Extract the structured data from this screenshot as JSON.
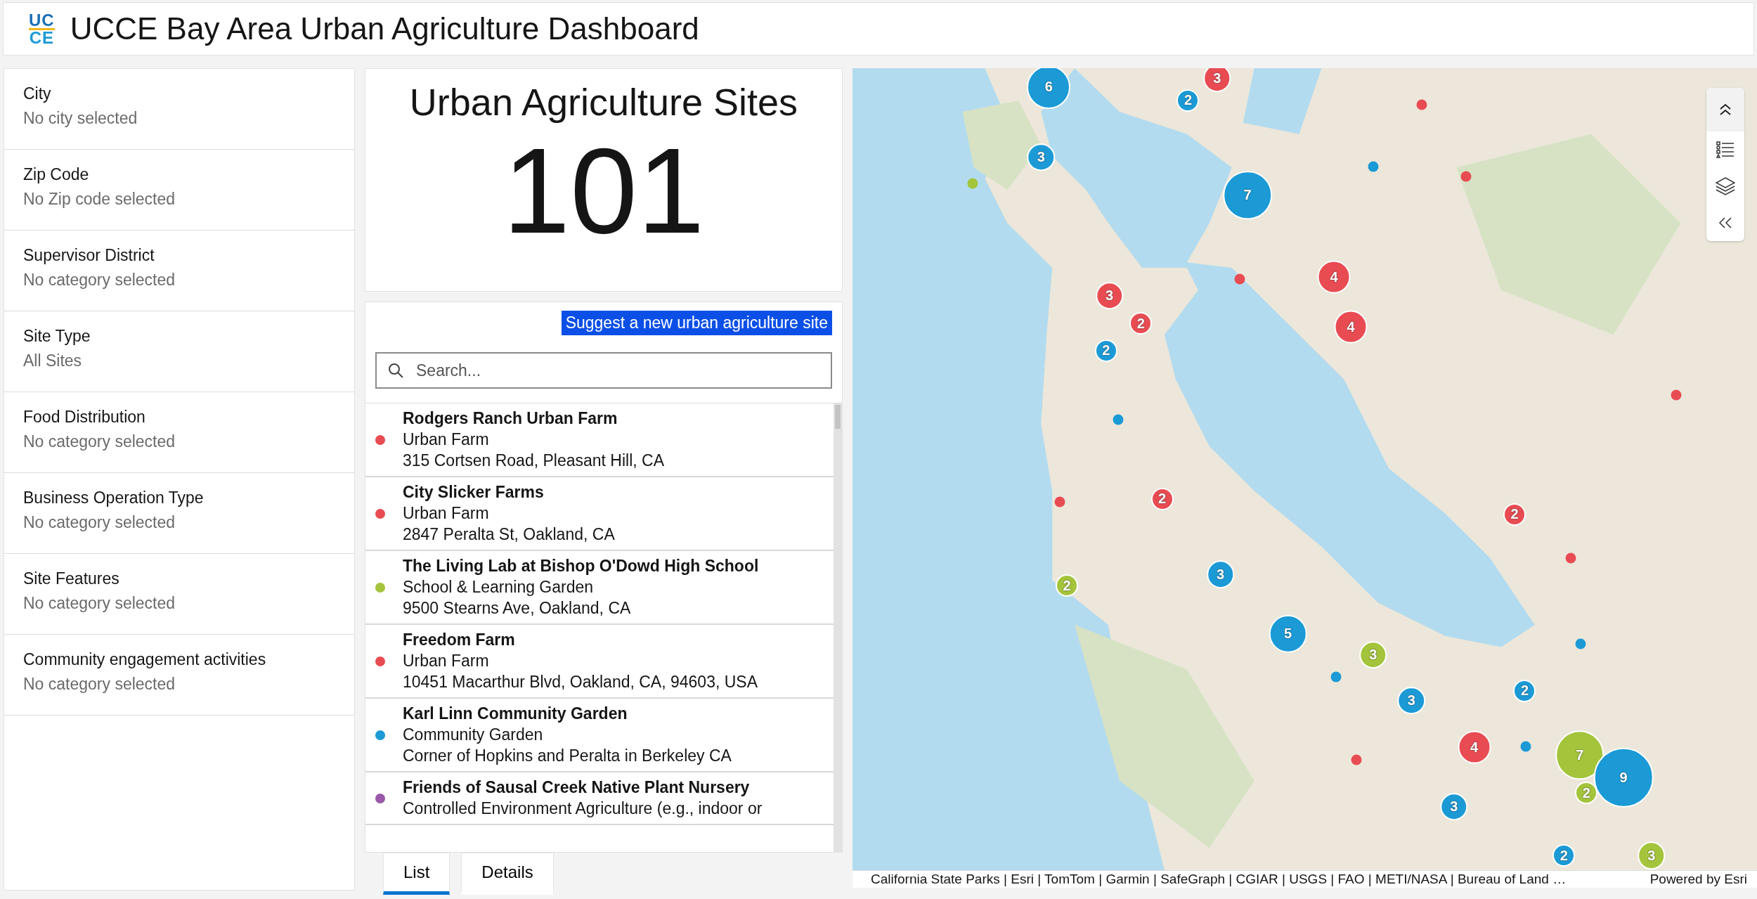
{
  "header": {
    "logo": [
      "UC",
      "CE"
    ],
    "title": "UCCE Bay Area Urban Agriculture Dashboard"
  },
  "filters": [
    {
      "label": "City",
      "value": "No city selected"
    },
    {
      "label": "Zip Code",
      "value": "No Zip code selected"
    },
    {
      "label": "Supervisor District",
      "value": "No category selected"
    },
    {
      "label": "Site Type",
      "value": "All Sites"
    },
    {
      "label": "Food Distribution",
      "value": "No category selected"
    },
    {
      "label": "Business Operation Type",
      "value": "No category selected"
    },
    {
      "label": "Site Features",
      "value": "No category selected"
    },
    {
      "label": "Community engagement activities",
      "value": "No category selected"
    }
  ],
  "stat": {
    "title": "Urban Agriculture Sites",
    "value": "101"
  },
  "suggest_button": "Suggest a new urban agriculture site",
  "search": {
    "placeholder": "Search..."
  },
  "sites": [
    {
      "name": "Rodgers Ranch Urban Farm",
      "type": "Urban Farm",
      "address": "315 Cortsen Road, Pleasant Hill, CA",
      "color": "#e84c52"
    },
    {
      "name": "City Slicker Farms",
      "type": "Urban Farm",
      "address": "2847 Peralta St, Oakland, CA",
      "color": "#e84c52"
    },
    {
      "name": "The Living Lab at Bishop O'Dowd High School",
      "type": "School & Learning Garden",
      "address": "9500 Stearns Ave, Oakland, CA",
      "color": "#a3c43b"
    },
    {
      "name": "Freedom Farm",
      "type": "Urban Farm",
      "address": "10451 Macarthur Blvd, Oakland, CA, 94603, USA",
      "color": "#e84c52"
    },
    {
      "name": "Karl Linn Community Garden",
      "type": "Community Garden",
      "address": "Corner of Hopkins and Peralta in Berkeley CA",
      "color": "#1b9ad6"
    },
    {
      "name": "Friends of Sausal Creek Native Plant Nursery",
      "type": "Controlled Environment Agriculture (e.g., indoor or",
      "color": "#9a58a8"
    }
  ],
  "tabs": [
    {
      "label": "List",
      "selected": true
    },
    {
      "label": "Details",
      "selected": false
    }
  ],
  "map": {
    "clusters": [
      {
        "count": "6",
        "color": "#1b9ad6"
      },
      {
        "count": "3",
        "color": "#e84c52"
      },
      {
        "count": "2",
        "color": "#1b9ad6"
      },
      {
        "count": "3",
        "color": "#1b9ad6"
      },
      {
        "count": "7",
        "color": "#1b9ad6"
      },
      {
        "count": "4",
        "color": "#e84c52"
      },
      {
        "count": "3",
        "color": "#e84c52"
      },
      {
        "count": "2",
        "color": "#e84c52"
      },
      {
        "count": "4",
        "color": "#e84c52"
      },
      {
        "count": "2",
        "color": "#1b9ad6"
      },
      {
        "count": "2",
        "color": "#e84c52"
      },
      {
        "count": "2",
        "color": "#e84c52"
      },
      {
        "count": "2",
        "color": "#a3c43b"
      },
      {
        "count": "3",
        "color": "#1b9ad6"
      },
      {
        "count": "5",
        "color": "#1b9ad6"
      },
      {
        "count": "3",
        "color": "#a3c43b"
      },
      {
        "count": "2",
        "color": "#1b9ad6"
      },
      {
        "count": "3",
        "color": "#1b9ad6"
      },
      {
        "count": "4",
        "color": "#e84c52"
      },
      {
        "count": "7",
        "color": "#a3c43b"
      },
      {
        "count": "9",
        "color": "#1b9ad6"
      },
      {
        "count": "2",
        "color": "#a3c43b"
      },
      {
        "count": "3",
        "color": "#1b9ad6"
      },
      {
        "count": "2",
        "color": "#1b9ad6"
      },
      {
        "count": "3",
        "color": "#a3c43b"
      }
    ],
    "points": [
      {
        "color": "#e84c52"
      },
      {
        "color": "#1b9ad6"
      },
      {
        "color": "#e84c52"
      },
      {
        "color": "#a3c43b"
      },
      {
        "color": "#e84c52"
      },
      {
        "color": "#1b9ad6"
      },
      {
        "color": "#e84c52"
      },
      {
        "color": "#e84c52"
      },
      {
        "color": "#1b9ad6"
      },
      {
        "color": "#e84c52"
      },
      {
        "color": "#1b9ad6"
      },
      {
        "color": "#1b9ad6"
      },
      {
        "color": "#e84c52"
      }
    ],
    "attribution": "California State Parks | Esri | TomTom | Garmin | SafeGraph | CGIAR | USGS | FAO | METI/NASA | Bureau of Land …",
    "powered_by": "Powered by Esri"
  }
}
